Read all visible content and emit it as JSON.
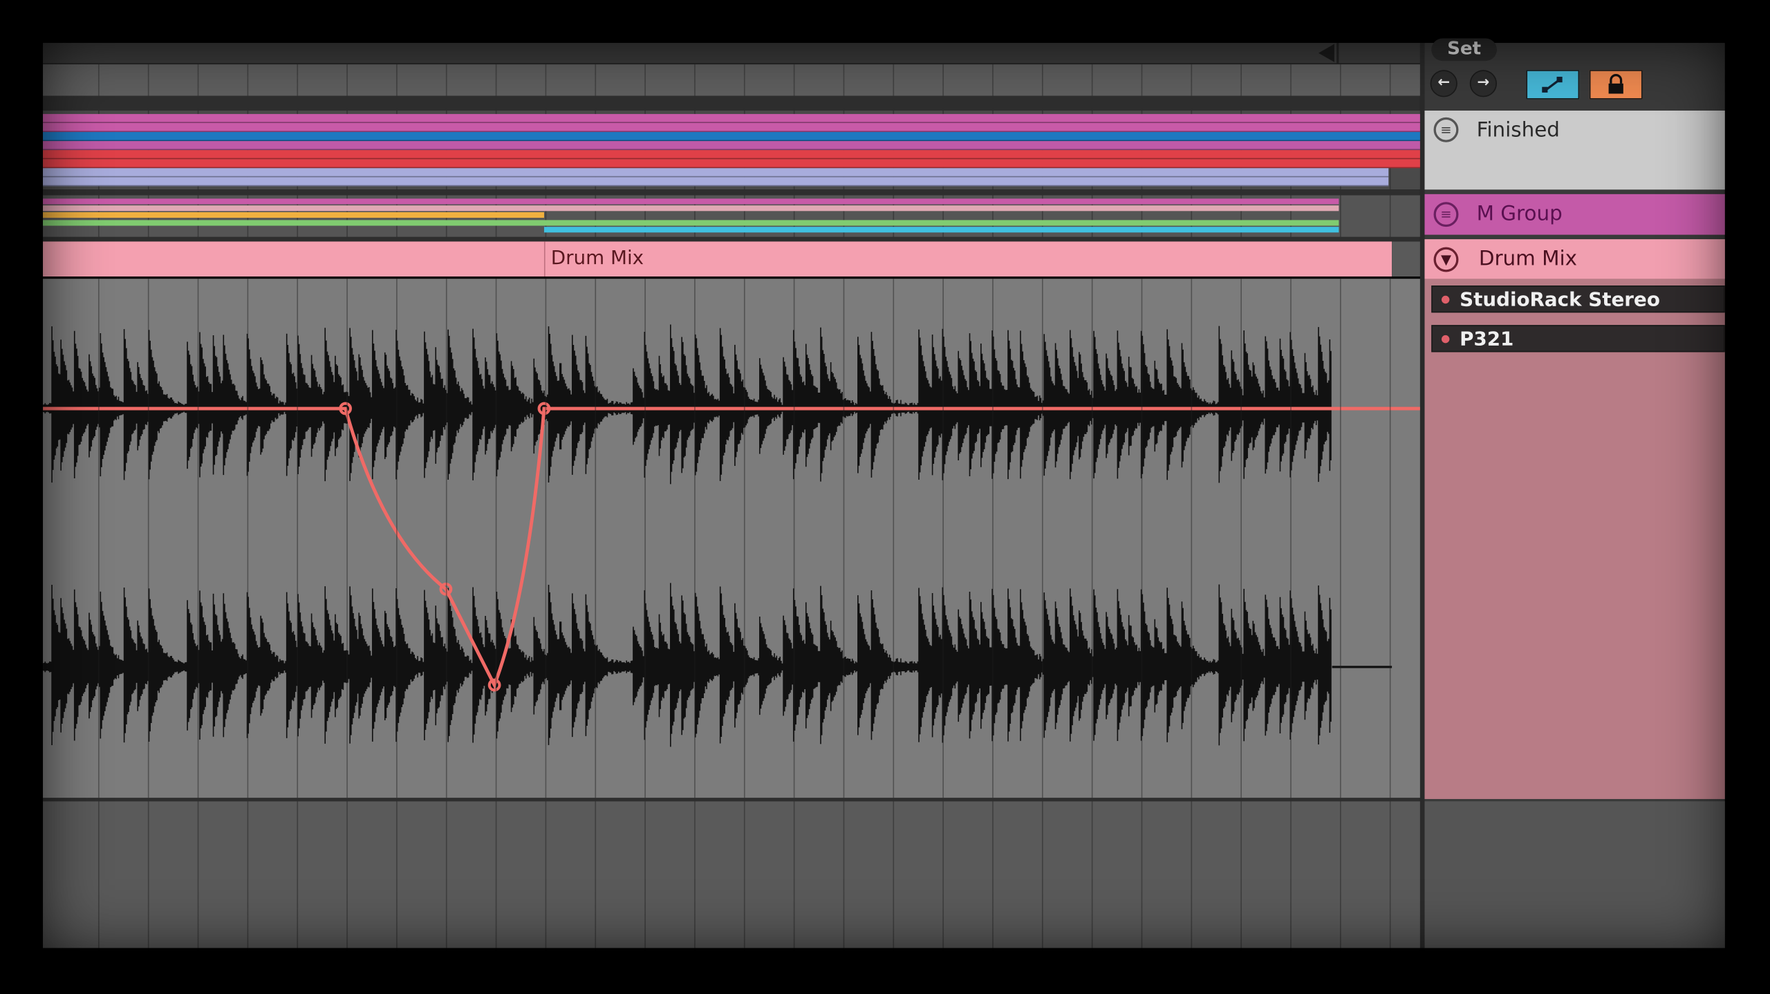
{
  "header": {
    "set_label": "Set"
  },
  "toolbar": {
    "prev_icon": "arrow-left-icon",
    "next_icon": "arrow-right-icon",
    "automation_icon": "automation-draw-icon",
    "lock_icon": "lock-icon",
    "automation_color": "#46b8d8",
    "lock_color": "#f08a50"
  },
  "arrangement": {
    "clip_name": "Drum Mix",
    "clip_color": "#f4a0b0",
    "automation_color": "#f06a66",
    "group1_lane_colors": [
      "#c85aa8",
      "#c85aa8",
      "#1e78c0",
      "#c05aa8",
      "#e04048",
      "#e04048",
      "#a8acdc",
      "#a8acdc"
    ],
    "group2_lane_colors": [
      "#c85aa8",
      "#e0a8b4",
      "#f0b040",
      "#80cc70",
      "#40c0e0"
    ]
  },
  "tracks": [
    {
      "name": "Finished",
      "icon": "group-fold-icon",
      "color": "#cbcbcb"
    },
    {
      "name": "M Group",
      "icon": "group-fold-icon",
      "color": "#c45aa8"
    },
    {
      "name": "Drum Mix",
      "icon": "collapse-triangle-icon",
      "color": "#f19fb0"
    }
  ],
  "devices": [
    {
      "name": "StudioRack Stereo"
    },
    {
      "name": "P321"
    }
  ]
}
